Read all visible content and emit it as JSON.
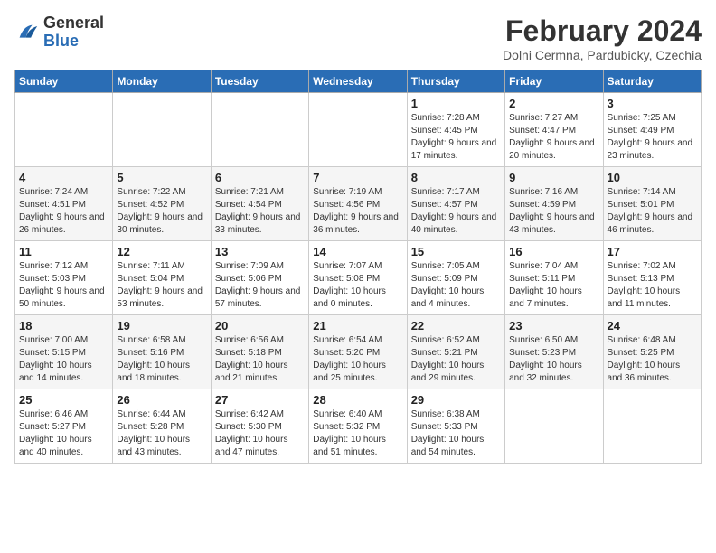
{
  "header": {
    "logo_general": "General",
    "logo_blue": "Blue",
    "month_year": "February 2024",
    "location": "Dolni Cermna, Pardubicky, Czechia"
  },
  "weekdays": [
    "Sunday",
    "Monday",
    "Tuesday",
    "Wednesday",
    "Thursday",
    "Friday",
    "Saturday"
  ],
  "weeks": [
    [
      {
        "day": "",
        "info": ""
      },
      {
        "day": "",
        "info": ""
      },
      {
        "day": "",
        "info": ""
      },
      {
        "day": "",
        "info": ""
      },
      {
        "day": "1",
        "info": "Sunrise: 7:28 AM\nSunset: 4:45 PM\nDaylight: 9 hours\nand 17 minutes."
      },
      {
        "day": "2",
        "info": "Sunrise: 7:27 AM\nSunset: 4:47 PM\nDaylight: 9 hours\nand 20 minutes."
      },
      {
        "day": "3",
        "info": "Sunrise: 7:25 AM\nSunset: 4:49 PM\nDaylight: 9 hours\nand 23 minutes."
      }
    ],
    [
      {
        "day": "4",
        "info": "Sunrise: 7:24 AM\nSunset: 4:51 PM\nDaylight: 9 hours\nand 26 minutes."
      },
      {
        "day": "5",
        "info": "Sunrise: 7:22 AM\nSunset: 4:52 PM\nDaylight: 9 hours\nand 30 minutes."
      },
      {
        "day": "6",
        "info": "Sunrise: 7:21 AM\nSunset: 4:54 PM\nDaylight: 9 hours\nand 33 minutes."
      },
      {
        "day": "7",
        "info": "Sunrise: 7:19 AM\nSunset: 4:56 PM\nDaylight: 9 hours\nand 36 minutes."
      },
      {
        "day": "8",
        "info": "Sunrise: 7:17 AM\nSunset: 4:57 PM\nDaylight: 9 hours\nand 40 minutes."
      },
      {
        "day": "9",
        "info": "Sunrise: 7:16 AM\nSunset: 4:59 PM\nDaylight: 9 hours\nand 43 minutes."
      },
      {
        "day": "10",
        "info": "Sunrise: 7:14 AM\nSunset: 5:01 PM\nDaylight: 9 hours\nand 46 minutes."
      }
    ],
    [
      {
        "day": "11",
        "info": "Sunrise: 7:12 AM\nSunset: 5:03 PM\nDaylight: 9 hours\nand 50 minutes."
      },
      {
        "day": "12",
        "info": "Sunrise: 7:11 AM\nSunset: 5:04 PM\nDaylight: 9 hours\nand 53 minutes."
      },
      {
        "day": "13",
        "info": "Sunrise: 7:09 AM\nSunset: 5:06 PM\nDaylight: 9 hours\nand 57 minutes."
      },
      {
        "day": "14",
        "info": "Sunrise: 7:07 AM\nSunset: 5:08 PM\nDaylight: 10 hours\nand 0 minutes."
      },
      {
        "day": "15",
        "info": "Sunrise: 7:05 AM\nSunset: 5:09 PM\nDaylight: 10 hours\nand 4 minutes."
      },
      {
        "day": "16",
        "info": "Sunrise: 7:04 AM\nSunset: 5:11 PM\nDaylight: 10 hours\nand 7 minutes."
      },
      {
        "day": "17",
        "info": "Sunrise: 7:02 AM\nSunset: 5:13 PM\nDaylight: 10 hours\nand 11 minutes."
      }
    ],
    [
      {
        "day": "18",
        "info": "Sunrise: 7:00 AM\nSunset: 5:15 PM\nDaylight: 10 hours\nand 14 minutes."
      },
      {
        "day": "19",
        "info": "Sunrise: 6:58 AM\nSunset: 5:16 PM\nDaylight: 10 hours\nand 18 minutes."
      },
      {
        "day": "20",
        "info": "Sunrise: 6:56 AM\nSunset: 5:18 PM\nDaylight: 10 hours\nand 21 minutes."
      },
      {
        "day": "21",
        "info": "Sunrise: 6:54 AM\nSunset: 5:20 PM\nDaylight: 10 hours\nand 25 minutes."
      },
      {
        "day": "22",
        "info": "Sunrise: 6:52 AM\nSunset: 5:21 PM\nDaylight: 10 hours\nand 29 minutes."
      },
      {
        "day": "23",
        "info": "Sunrise: 6:50 AM\nSunset: 5:23 PM\nDaylight: 10 hours\nand 32 minutes."
      },
      {
        "day": "24",
        "info": "Sunrise: 6:48 AM\nSunset: 5:25 PM\nDaylight: 10 hours\nand 36 minutes."
      }
    ],
    [
      {
        "day": "25",
        "info": "Sunrise: 6:46 AM\nSunset: 5:27 PM\nDaylight: 10 hours\nand 40 minutes."
      },
      {
        "day": "26",
        "info": "Sunrise: 6:44 AM\nSunset: 5:28 PM\nDaylight: 10 hours\nand 43 minutes."
      },
      {
        "day": "27",
        "info": "Sunrise: 6:42 AM\nSunset: 5:30 PM\nDaylight: 10 hours\nand 47 minutes."
      },
      {
        "day": "28",
        "info": "Sunrise: 6:40 AM\nSunset: 5:32 PM\nDaylight: 10 hours\nand 51 minutes."
      },
      {
        "day": "29",
        "info": "Sunrise: 6:38 AM\nSunset: 5:33 PM\nDaylight: 10 hours\nand 54 minutes."
      },
      {
        "day": "",
        "info": ""
      },
      {
        "day": "",
        "info": ""
      }
    ]
  ]
}
